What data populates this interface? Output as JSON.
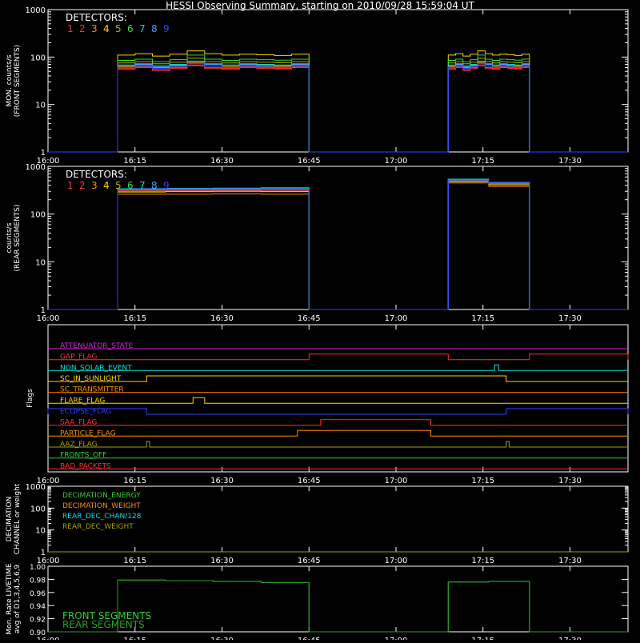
{
  "title": "HESSI Observing Summary, starting on 2010/09/28 15:59:04 UT",
  "time_ticks": [
    "16:00",
    "16:15",
    "16:30",
    "16:45",
    "17:00",
    "17:15",
    "17:30"
  ],
  "detectors": {
    "label": "DETECTORS:",
    "numbers": [
      "1",
      "2",
      "3",
      "4",
      "5",
      "6",
      "7",
      "8",
      "9"
    ],
    "colors": [
      "#ff3030",
      "#ff3030",
      "#ff8c00",
      "#ffd700",
      "#b8b000",
      "#30e030",
      "#00e0c0",
      "#40a0ff",
      "#3040ff"
    ]
  },
  "colors": {
    "axes": "#ffffff",
    "white": "#ffffff",
    "red": "#ff3030",
    "orange": "#ff8c00",
    "yellow": "#ffd700",
    "olive": "#a8a000",
    "green": "#30d030",
    "cyan": "#00e0e0",
    "blue": "#3040ff",
    "magenta": "#e020e0"
  },
  "chart_data": [
    {
      "type": "line",
      "panel": "front",
      "ylabel": "MON. counts/s\n(FRONT SEGMENTS)",
      "yscale": "log",
      "ylim": [
        1,
        1000
      ],
      "ytick_labels": [
        "1",
        "10",
        "100",
        "1000"
      ],
      "xlim": [
        "16:00",
        "17:40"
      ],
      "observation_windows": [
        [
          "16:12",
          "16:45"
        ],
        [
          "17:09",
          "17:23"
        ]
      ],
      "series": [
        {
          "name": "1",
          "values": [
            55,
            60,
            52,
            58,
            65,
            57,
            55,
            60,
            58,
            56,
            60
          ]
        },
        {
          "name": "2",
          "values": [
            57,
            62,
            55,
            60,
            68,
            60,
            58,
            62,
            60,
            58,
            62
          ]
        },
        {
          "name": "3",
          "values": [
            62,
            66,
            60,
            65,
            75,
            65,
            62,
            66,
            64,
            63,
            66
          ]
        },
        {
          "name": "4",
          "values": [
            110,
            118,
            105,
            115,
            135,
            118,
            110,
            115,
            112,
            108,
            115
          ]
        },
        {
          "name": "5",
          "values": [
            75,
            80,
            72,
            78,
            95,
            80,
            75,
            80,
            78,
            76,
            80
          ]
        },
        {
          "name": "6",
          "values": [
            85,
            90,
            80,
            88,
            110,
            90,
            85,
            90,
            88,
            86,
            90
          ]
        },
        {
          "name": "7",
          "values": [
            68,
            72,
            65,
            70,
            82,
            72,
            68,
            72,
            70,
            68,
            72
          ]
        },
        {
          "name": "8",
          "values": [
            65,
            70,
            62,
            68,
            80,
            70,
            66,
            70,
            68,
            66,
            70
          ]
        },
        {
          "name": "9",
          "values": [
            60,
            64,
            58,
            62,
            72,
            64,
            60,
            64,
            62,
            60,
            64
          ]
        }
      ]
    },
    {
      "type": "line",
      "panel": "rear",
      "ylabel": "counts/s\n(REAR SEGMENTS)",
      "yscale": "log",
      "ylim": [
        1,
        1000
      ],
      "ytick_labels": [
        "1",
        "10",
        "100",
        "1000"
      ],
      "xlim": [
        "16:00",
        "17:40"
      ],
      "observation_windows": [
        [
          "16:12",
          "16:45"
        ],
        [
          "17:09",
          "17:23"
        ]
      ],
      "series": [
        {
          "name": "1",
          "values": [
            300,
            305,
            310,
            300,
            520,
            440
          ]
        },
        {
          "name": "2",
          "values": [
            310,
            315,
            320,
            310,
            500,
            430
          ]
        },
        {
          "name": "3",
          "values": [
            260,
            262,
            265,
            262,
            450,
            380
          ]
        },
        {
          "name": "4",
          "values": [
            290,
            295,
            300,
            295,
            480,
            410
          ]
        },
        {
          "name": "5",
          "values": [
            330,
            335,
            340,
            335,
            520,
            440
          ]
        },
        {
          "name": "6",
          "values": [
            320,
            325,
            330,
            325,
            510,
            435
          ]
        },
        {
          "name": "7",
          "values": [
            340,
            345,
            350,
            355,
            540,
            460
          ]
        },
        {
          "name": "8",
          "values": [
            335,
            340,
            345,
            340,
            530,
            455
          ]
        },
        {
          "name": "9",
          "values": [
            325,
            330,
            335,
            330,
            515,
            445
          ]
        }
      ]
    },
    {
      "type": "line",
      "panel": "flags",
      "ylabel": "Flags",
      "xlim": [
        "16:00",
        "17:40"
      ],
      "flags": [
        {
          "name": "ATTENUATOR_STATE",
          "color": "magenta",
          "high": []
        },
        {
          "name": "GAP_FLAG",
          "color": "red",
          "high": [
            [
              "16:45",
              "17:09"
            ],
            [
              "17:23",
              "17:40"
            ]
          ]
        },
        {
          "name": "NON_SOLAR_EVENT",
          "color": "cyan",
          "high": [
            [
              "17:17",
              "17:17.7"
            ]
          ]
        },
        {
          "name": "SC_IN_SUNLIGHT",
          "color": "yellow",
          "high": [
            [
              "16:17",
              "17:19"
            ]
          ]
        },
        {
          "name": "SC_TRANSMITTER",
          "color": "orange",
          "high": []
        },
        {
          "name": "FLARE_FLAG",
          "color": "yellow",
          "high": [
            [
              "16:25",
              "16:27"
            ]
          ]
        },
        {
          "name": "ECLIPSE_FLAG",
          "color": "blue",
          "high": [
            [
              "16:00",
              "16:17"
            ],
            [
              "17:19",
              "17:40"
            ]
          ]
        },
        {
          "name": "SAA_FLAG",
          "color": "red",
          "high": [
            [
              "16:47",
              "17:06"
            ]
          ]
        },
        {
          "name": "PARTICLE_FLAG",
          "color": "orange",
          "high": [
            [
              "16:43",
              "17:06"
            ]
          ]
        },
        {
          "name": "AAZ_FLAG",
          "color": "olive",
          "high": [
            [
              "16:17",
              "16:17.5"
            ],
            [
              "17:19",
              "17:19.5"
            ]
          ]
        },
        {
          "name": "FRONTS_OFF",
          "color": "green",
          "high": []
        },
        {
          "name": "BAD_PACKETS",
          "color": "red",
          "high": []
        }
      ]
    },
    {
      "type": "line",
      "panel": "decimation",
      "ylabel": "DECIMATION\nCHANNEL or weight",
      "yscale": "log",
      "ylim": [
        1,
        1000
      ],
      "ytick_labels": [
        "1",
        "10",
        "100",
        "1000"
      ],
      "xlim": [
        "16:00",
        "17:40"
      ],
      "series": [
        {
          "name": "DECIMATION_ENERGY",
          "color": "green",
          "values": [
            0
          ]
        },
        {
          "name": "DECIMATION_WEIGHT",
          "color": "orange",
          "values": [
            1
          ]
        },
        {
          "name": "REAR_DEC_CHAN/128",
          "color": "cyan",
          "values": [
            0
          ]
        },
        {
          "name": "REAR_DEC_WEIGHT",
          "color": "olive",
          "values": [
            1
          ]
        }
      ]
    },
    {
      "type": "line",
      "panel": "livetime",
      "ylabel": "Mon. Rate LIVETIME\navg of D1,3,4,5,6,9",
      "ylim": [
        0.9,
        1.0
      ],
      "ytick_labels": [
        "0.90",
        "0.92",
        "0.94",
        "0.96",
        "0.98",
        "1.00"
      ],
      "xlim": [
        "16:00",
        "17:40"
      ],
      "observation_windows": [
        [
          "16:12",
          "16:45"
        ],
        [
          "17:09",
          "17:23"
        ]
      ],
      "series": [
        {
          "name": "FRONT SEGMENTS",
          "color": "green",
          "values": [
            0.979,
            0.978,
            0.977,
            0.975,
            0.976,
            0.977
          ]
        },
        {
          "name": "REAR SEGMENTS",
          "color": "green",
          "values": [
            0.979,
            0.978,
            0.977,
            0.975,
            0.976,
            0.977
          ]
        }
      ]
    }
  ]
}
